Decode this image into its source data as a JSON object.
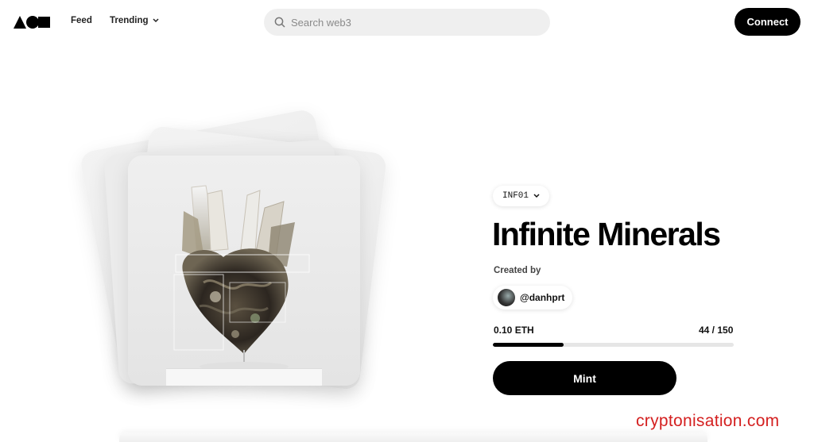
{
  "header": {
    "logo_icon": "aoe-shapes-logo",
    "nav": [
      {
        "label": "Feed"
      },
      {
        "label": "Trending",
        "icon": "chevron-down-icon"
      }
    ],
    "search": {
      "placeholder": "Search web3",
      "value": "",
      "icon": "search-icon"
    },
    "connect_label": "Connect"
  },
  "collection": {
    "token_chip": "INF01",
    "title": "Infinite Minerals",
    "created_by_label": "Created by",
    "creator": "@danhprt",
    "price": "0.10 ETH",
    "minted_count": "44 / 150",
    "mint_progress": 0.293,
    "mint_label": "Mint"
  },
  "watermark": "cryptonisation.com",
  "colors": {
    "accent": "#000000",
    "watermark": "#d42020",
    "search_bg": "#efefef"
  }
}
